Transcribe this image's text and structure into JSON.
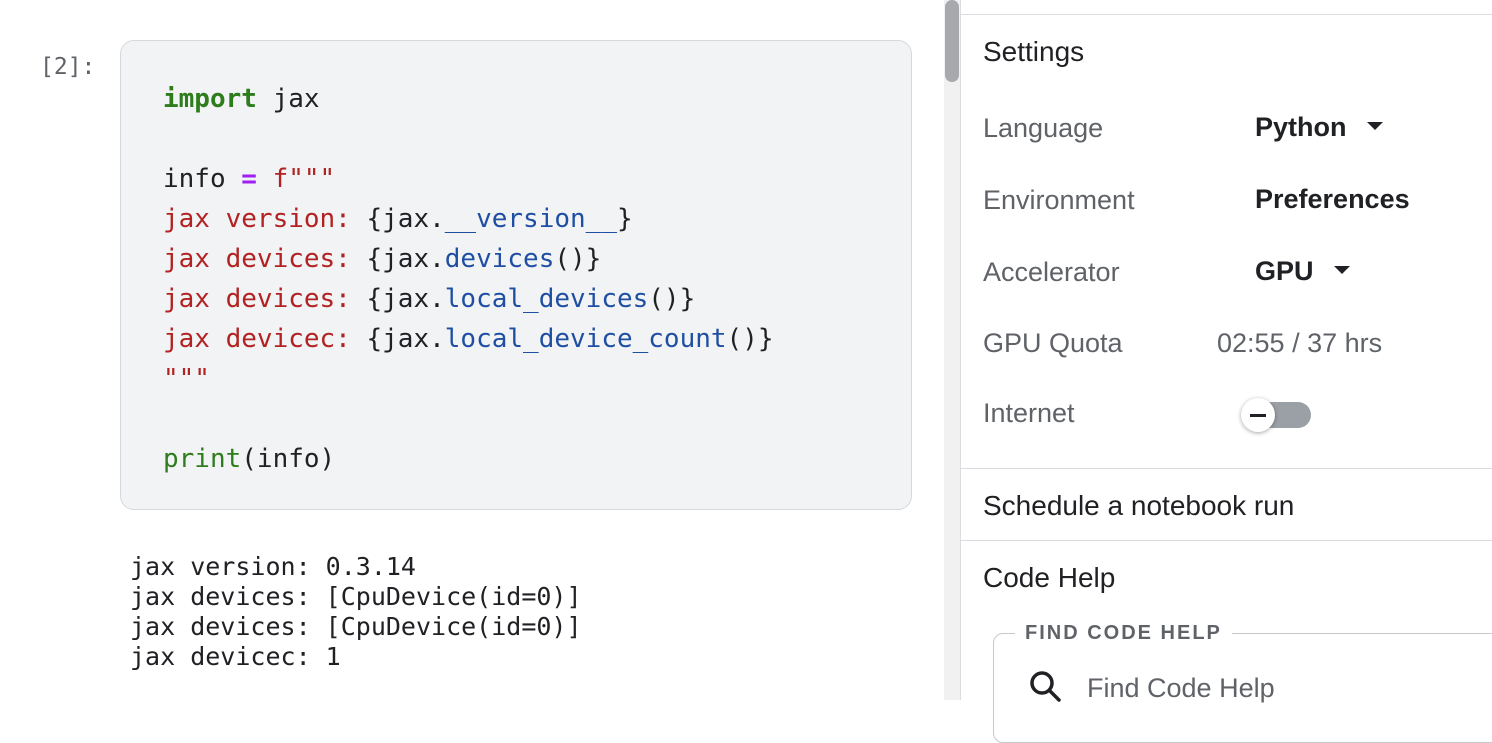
{
  "notebook": {
    "cell_prompt": "[2]:",
    "code": {
      "l1_kw": "import",
      "l1_rest": " jax",
      "l3_var": "info ",
      "l3_op": "=",
      "l3_str": " f\"\"\"",
      "l4_str": "jax version: ",
      "l4_a": "{jax.",
      "l4_attr": "__version__",
      "l4_b": "}",
      "l5_str": "jax devices: ",
      "l5_a": "{jax.",
      "l5_attr": "devices",
      "l5_b": "()}",
      "l6_str": "jax devices: ",
      "l6_a": "{jax.",
      "l6_attr": "local_devices",
      "l6_b": "()}",
      "l7_str": "jax devicec: ",
      "l7_a": "{jax.",
      "l7_attr": "local_device_count",
      "l7_b": "()}",
      "l8_str": "\"\"\"",
      "l10_fn": "print",
      "l10_rest": "(info)"
    },
    "output_lines": [
      "jax version: 0.3.14",
      "jax devices: [CpuDevice(id=0)]",
      "jax devices: [CpuDevice(id=0)]",
      "jax devicec: 1"
    ]
  },
  "panel": {
    "settings_title": "Settings",
    "language_label": "Language",
    "language_value": "Python",
    "environment_label": "Environment",
    "environment_value": "Preferences",
    "accelerator_label": "Accelerator",
    "accelerator_value": "GPU",
    "gpu_quota_label": "GPU Quota",
    "gpu_quota_value": "02:55 / 37 hrs",
    "internet_label": "Internet",
    "internet_on": false,
    "schedule_label": "Schedule a notebook run",
    "code_help_title": "Code Help",
    "find_code_help_legend": "FIND CODE HELP",
    "find_code_help_placeholder": "Find Code Help"
  },
  "icons": {
    "dropdown": "caret-down-icon",
    "search": "search-icon",
    "toggle_off": "minus-icon"
  },
  "colors": {
    "keyword": "#2e7d1d",
    "string": "#b22222",
    "attribute": "#1f4fa3",
    "operator": "#a020f0",
    "cell_background": "#f1f3f4"
  }
}
